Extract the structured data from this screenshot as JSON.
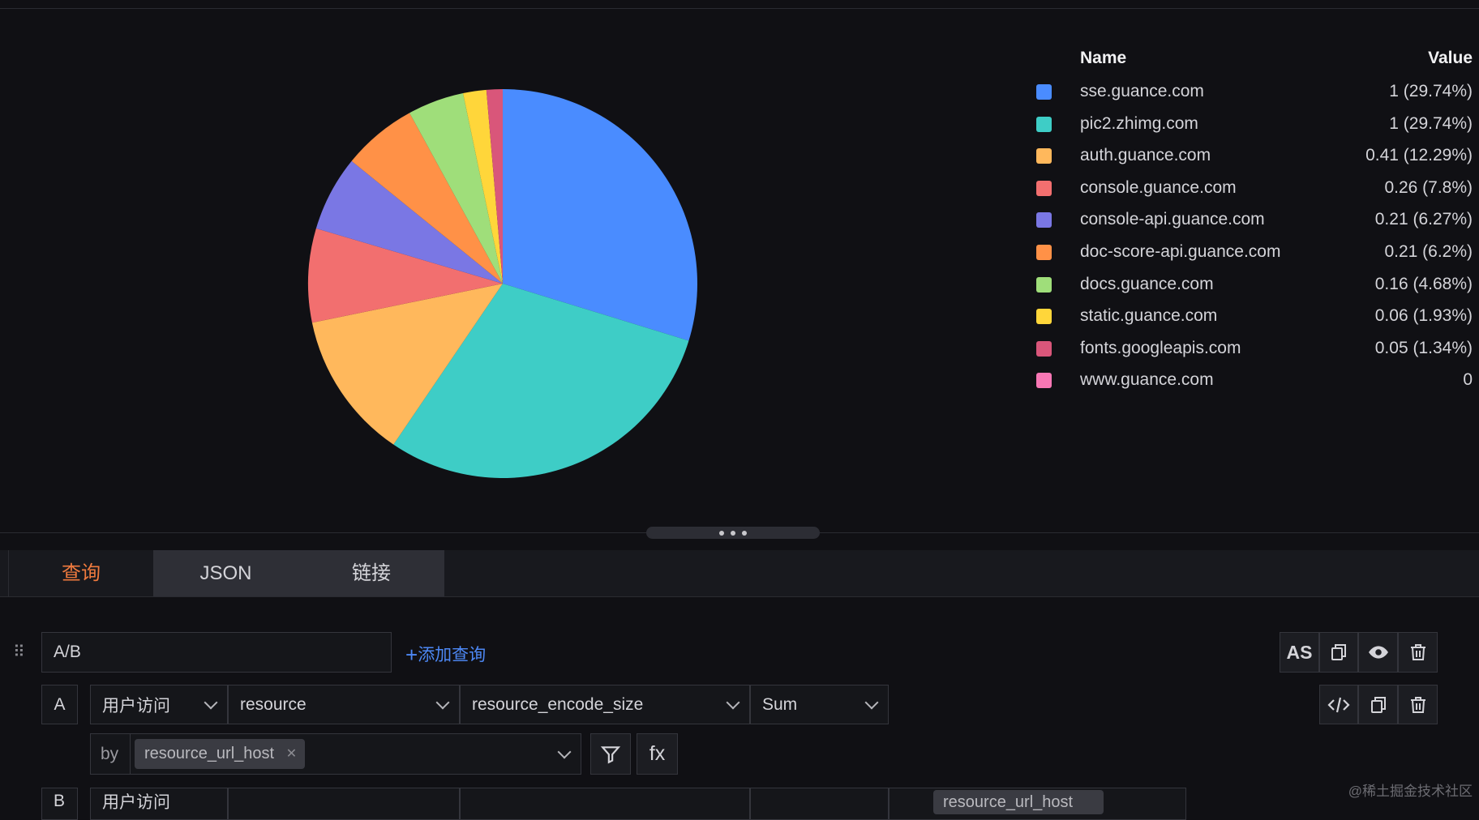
{
  "chart_data": {
    "type": "pie",
    "legend_header": {
      "name": "Name",
      "value": "Value"
    },
    "legend_position": "right",
    "slices": [
      {
        "name": "sse.guance.com",
        "value": 1,
        "value_label": "1 (29.74%)",
        "percent": 29.74,
        "color": "#4a8cff"
      },
      {
        "name": "pic2.zhimg.com",
        "value": 1,
        "value_label": "1 (29.74%)",
        "percent": 29.74,
        "color": "#3ecdc6"
      },
      {
        "name": "auth.guance.com",
        "value": 0.41,
        "value_label": "0.41 (12.29%)",
        "percent": 12.29,
        "color": "#ffb85c"
      },
      {
        "name": "console.guance.com",
        "value": 0.26,
        "value_label": "0.26 (7.8%)",
        "percent": 7.8,
        "color": "#f26f6f"
      },
      {
        "name": "console-api.guance.com",
        "value": 0.21,
        "value_label": "0.21 (6.27%)",
        "percent": 6.27,
        "color": "#7a77e4"
      },
      {
        "name": "doc-score-api.guance.com",
        "value": 0.21,
        "value_label": "0.21 (6.2%)",
        "percent": 6.2,
        "color": "#ff9147"
      },
      {
        "name": "docs.guance.com",
        "value": 0.16,
        "value_label": "0.16 (4.68%)",
        "percent": 4.68,
        "color": "#9fde7a"
      },
      {
        "name": "static.guance.com",
        "value": 0.06,
        "value_label": "0.06 (1.93%)",
        "percent": 1.93,
        "color": "#ffd63a"
      },
      {
        "name": "fonts.googleapis.com",
        "value": 0.05,
        "value_label": "0.05 (1.34%)",
        "percent": 1.34,
        "color": "#d9567a"
      },
      {
        "name": "www.guance.com",
        "value": 0,
        "value_label": "0",
        "percent": 0,
        "color": "#f777b4"
      }
    ]
  },
  "tabs": {
    "query": "查询",
    "json": "JSON",
    "link": "链接"
  },
  "query": {
    "formula_value": "A/B",
    "add_query_label": "添加查询",
    "as_label": "AS",
    "row_a": {
      "label": "A",
      "source": "用户访问",
      "measurement": "resource",
      "field": "resource_encode_size",
      "aggregation": "Sum",
      "by_label": "by",
      "group_tag": "resource_url_host",
      "fx_label": "fx"
    },
    "row_b": {
      "label": "B",
      "source": "用户访问",
      "group_tag": "resource_url_host"
    }
  },
  "watermark": "@稀土掘金技术社区"
}
